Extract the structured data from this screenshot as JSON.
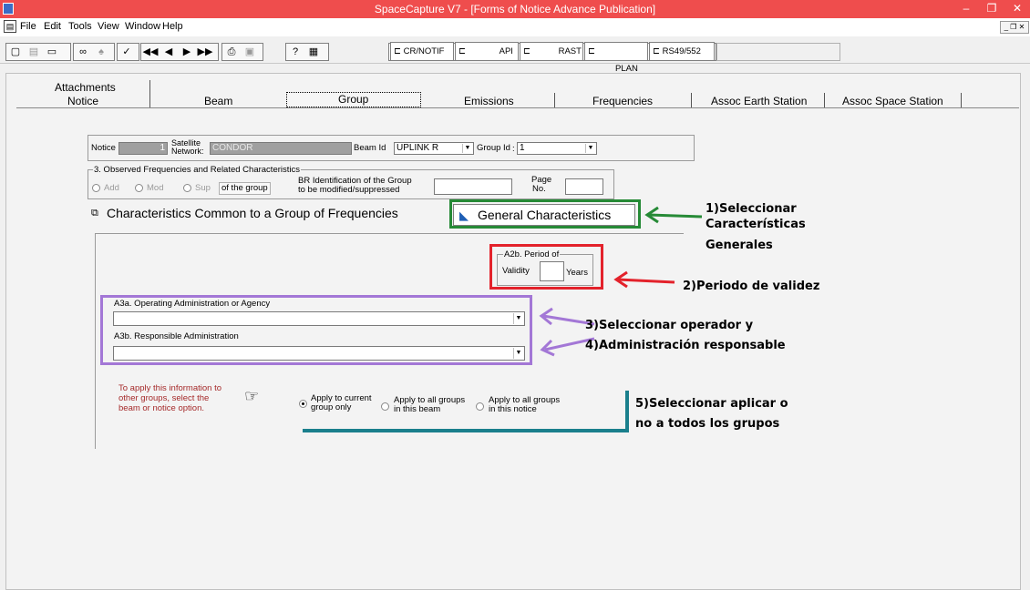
{
  "window": {
    "title": "SpaceCapture V7 - [Forms of Notice Advance Publication]",
    "min_glyph": "–",
    "max_glyph": "❐",
    "close_glyph": "✕"
  },
  "menu": {
    "items": [
      "File",
      "Edit",
      "Tools",
      "View",
      "Window",
      "Help"
    ]
  },
  "toolbar": {
    "panel_tabs": [
      "CR/NOTIF",
      "API",
      "RAST",
      "PLAN",
      "RS49/552"
    ]
  },
  "tabs": {
    "attachments": "Attachments",
    "items": [
      "Notice",
      "Beam",
      "Group",
      "Emissions",
      "Frequencies",
      "Assoc Earth Station",
      "Assoc Space Station"
    ],
    "active": "Group"
  },
  "notice_row": {
    "notice_label": "Notice",
    "notice_value": "1",
    "satellite_label": "Satellite\nNetwork:",
    "satellite_value": "CONDOR",
    "beam_label": "Beam Id",
    "beam_value": "UPLINK R",
    "group_label": "Group Id",
    "group_value": "1"
  },
  "observed": {
    "legend": "3. Observed Frequencies and Related Characteristics",
    "add": "Add",
    "mod": "Mod",
    "sup": "Sup",
    "of_group": "of the group",
    "br_label_1": "BR Identification of the Group",
    "br_label_2": "to be modified/suppressed",
    "page_label_1": "Page",
    "page_label_2": "No."
  },
  "section": {
    "title": "Characteristics Common to a Group of Frequencies",
    "general_button": "General Characteristics"
  },
  "period": {
    "legend": "A2b. Period of",
    "validity_label": "Validity",
    "years_label": "Years",
    "value": ""
  },
  "admin": {
    "operating_label": "A3a.  Operating Administration or Agency",
    "operating_value": "",
    "responsible_label": "A3b.  Responsible Administration",
    "responsible_value": ""
  },
  "apply": {
    "hint_1": "To apply this information to",
    "hint_2": "other groups, select the",
    "hint_3": "beam or notice option.",
    "opt_current_1": "Apply to current",
    "opt_current_2": "group only",
    "opt_beam_1": "Apply to all groups",
    "opt_beam_2": "in this beam",
    "opt_notice_1": "Apply to all groups",
    "opt_notice_2": "in this notice",
    "selected": "current"
  },
  "annotations": {
    "a1_1": "1)Seleccionar",
    "a1_2": "Características",
    "a1_3": "Generales",
    "a2": "2)Periodo de validez",
    "a3": "3)Seleccionar operador y",
    "a4": "4)Administración responsable",
    "a5_1": "5)Seleccionar aplicar o",
    "a5_2": "no a todos los grupos"
  },
  "colors": {
    "titlebar": "#ef4d4d",
    "green_highlight": "#268a36",
    "red_highlight": "#e3222b",
    "purple_highlight": "#a377d6",
    "teal_line": "#1a7f8c"
  }
}
